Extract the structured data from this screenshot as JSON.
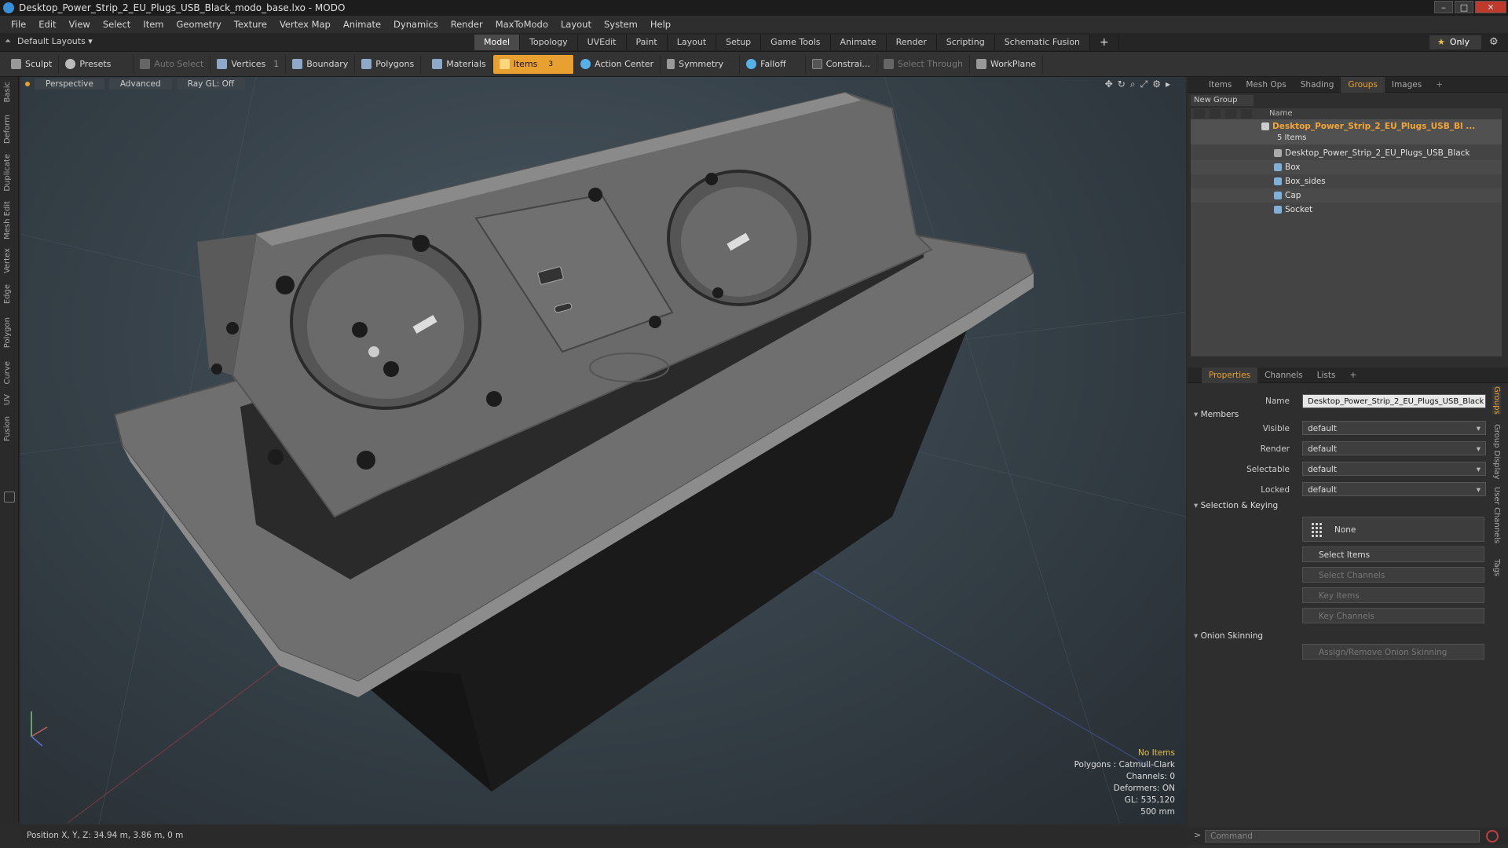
{
  "window": {
    "title": "Desktop_Power_Strip_2_EU_Plugs_USB_Black_modo_base.lxo - MODO",
    "controls": [
      "–",
      "□",
      "✕"
    ]
  },
  "menu": [
    "File",
    "Edit",
    "View",
    "Select",
    "Item",
    "Geometry",
    "Texture",
    "Vertex Map",
    "Animate",
    "Dynamics",
    "Render",
    "MaxToModo",
    "Layout",
    "System",
    "Help"
  ],
  "layout_selector": "Default Layouts ▾",
  "mode_tabs": [
    "Model",
    "Topology",
    "UVEdit",
    "Paint",
    "Layout",
    "Setup",
    "Game Tools",
    "Animate",
    "Render",
    "Scripting",
    "Schematic Fusion",
    "+"
  ],
  "active_mode_tab": "Model",
  "only_button": {
    "star": "★",
    "label": "Only"
  },
  "toolbar": {
    "sculpt": "Sculpt",
    "presets": "Presets",
    "auto_select": "Auto Select",
    "vertices": "Vertices",
    "vertices_count": "1",
    "boundary": "Boundary",
    "polygons": "Polygons",
    "materials": "Materials",
    "items": "Items",
    "items_count": "3",
    "action_center": "Action Center",
    "symmetry": "Symmetry",
    "falloff": "Falloff",
    "constraint": "Constrai...",
    "select_through": "Select Through",
    "workplane": "WorkPlane"
  },
  "left_tabs": [
    "Basic",
    "Deform",
    "Duplicate",
    "Mesh Edit",
    "Vertex",
    "Edge",
    "Polygon",
    "Curve",
    "UV",
    "Fusion"
  ],
  "viewport": {
    "view_mode": "Perspective",
    "shading": "Advanced",
    "raygl": "Ray GL: Off",
    "info": {
      "selection": "No Items",
      "polygons": "Polygons : Catmull-Clark",
      "channels": "Channels: 0",
      "deformers": "Deformers: ON",
      "gl": "GL: 535,120",
      "scale": "500 mm"
    }
  },
  "status": {
    "position": "Position X, Y, Z:   34.94 m, 3.86 m, 0 m"
  },
  "items_panel": {
    "tabs": [
      "Items",
      "Mesh Ops",
      "Shading",
      "Groups",
      "Images",
      "+"
    ],
    "active_tab": "Groups",
    "new_group": "New Group",
    "name_header": "Name",
    "group": {
      "name": "Desktop_Power_Strip_2_EU_Plugs_USB_Bl ...",
      "count": "5 Items"
    },
    "children": [
      "Desktop_Power_Strip_2_EU_Plugs_USB_Black",
      "Box",
      "Box_sides",
      "Cap",
      "Socket"
    ]
  },
  "properties": {
    "tabs": [
      "Properties",
      "Channels",
      "Lists",
      "+"
    ],
    "active_tab": "Properties",
    "name_label": "Name",
    "name_value": "Desktop_Power_Strip_2_EU_Plugs_USB_Black",
    "members_section": "Members",
    "visible_label": "Visible",
    "visible_value": "default",
    "render_label": "Render",
    "render_value": "default",
    "selectable_label": "Selectable",
    "selectable_value": "default",
    "locked_label": "Locked",
    "locked_value": "default",
    "selection_section": "Selection & Keying",
    "none_button": "None",
    "select_items": "Select Items",
    "select_channels": "Select Channels",
    "key_items": "Key Items",
    "key_channels": "Key Channels",
    "onion_section": "Onion Skinning",
    "onion_button": "Assign/Remove Onion Skinning",
    "side_tabs": [
      "Groups",
      "Group Display",
      "User Channels",
      "Tags"
    ]
  },
  "command": {
    "arrow": ">",
    "placeholder": "Command"
  },
  "colors": {
    "accent": "#e8a030",
    "group_text": "#f3a535"
  }
}
